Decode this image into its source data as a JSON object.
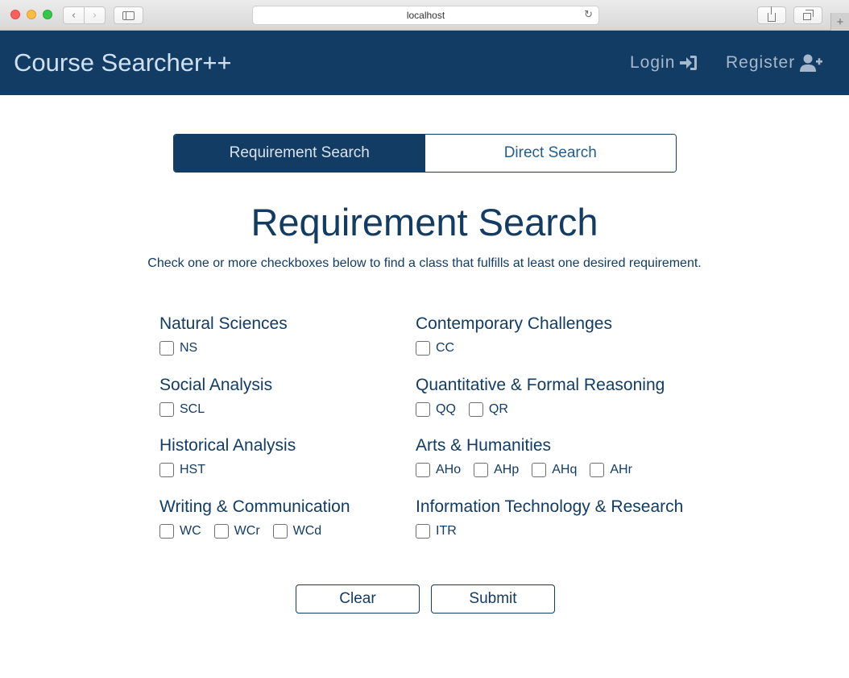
{
  "browser": {
    "url": "localhost",
    "back_icon": "chevron-left-icon",
    "forward_icon": "chevron-right-icon",
    "reload_icon": "reload-icon",
    "new_tab_icon": "plus-icon"
  },
  "navbar": {
    "brand": "Course Searcher++",
    "login": "Login",
    "register": "Register",
    "color": "#133c64"
  },
  "tabs": {
    "requirement": "Requirement Search",
    "direct": "Direct Search",
    "active": "Requirement Search"
  },
  "page": {
    "title": "Requirement Search",
    "subtitle": "Check one or more checkboxes below to find a class that fulfills at least one desired requirement."
  },
  "groups": [
    {
      "title": "Natural Sciences",
      "options": [
        "NS"
      ]
    },
    {
      "title": "Contemporary Challenges",
      "options": [
        "CC"
      ]
    },
    {
      "title": "Social Analysis",
      "options": [
        "SCL"
      ]
    },
    {
      "title": "Quantitative & Formal Reasoning",
      "options": [
        "QQ",
        "QR"
      ]
    },
    {
      "title": "Historical Analysis",
      "options": [
        "HST"
      ]
    },
    {
      "title": "Arts & Humanities",
      "options": [
        "AHo",
        "AHp",
        "AHq",
        "AHr"
      ]
    },
    {
      "title": "Writing & Communication",
      "options": [
        "WC",
        "WCr",
        "WCd"
      ]
    },
    {
      "title": "Information Technology & Research",
      "options": [
        "ITR"
      ]
    }
  ],
  "buttons": {
    "clear": "Clear",
    "submit": "Submit"
  }
}
